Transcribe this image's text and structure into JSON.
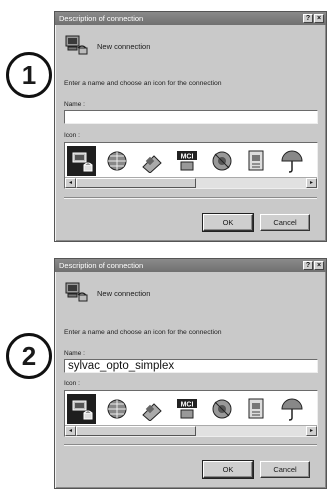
{
  "steps": [
    "1",
    "2"
  ],
  "dialogs": [
    {
      "title": "Description of connection",
      "help_label": "?",
      "close_label": "×",
      "connection_name": "New connection",
      "instruction": "Enter a name and choose an icon for the connection",
      "name_label": "Name :",
      "name_value": "",
      "icon_label": "Icon :",
      "icons": [
        "connection-icon",
        "globe-icon",
        "phone-icon",
        "mci-icon",
        "phone-globe-icon",
        "document-icon",
        "umbrella-icon"
      ],
      "selected_icon": 0,
      "mci_label": "MCI",
      "scroll_left": "◂",
      "scroll_right": "▸",
      "ok_label": "OK",
      "cancel_label": "Cancel"
    },
    {
      "title": "Description of connection",
      "help_label": "?",
      "close_label": "×",
      "connection_name": "New connection",
      "instruction": "Enter a name and choose an icon for the connection",
      "name_label": "Name :",
      "name_value": "sylvac_opto_simplex",
      "icon_label": "Icon :",
      "icons": [
        "connection-icon",
        "globe-icon",
        "phone-icon",
        "mci-icon",
        "phone-globe-icon",
        "document-icon",
        "umbrella-icon"
      ],
      "selected_icon": 0,
      "mci_label": "MCI",
      "scroll_left": "◂",
      "scroll_right": "▸",
      "ok_label": "OK",
      "cancel_label": "Cancel"
    }
  ]
}
